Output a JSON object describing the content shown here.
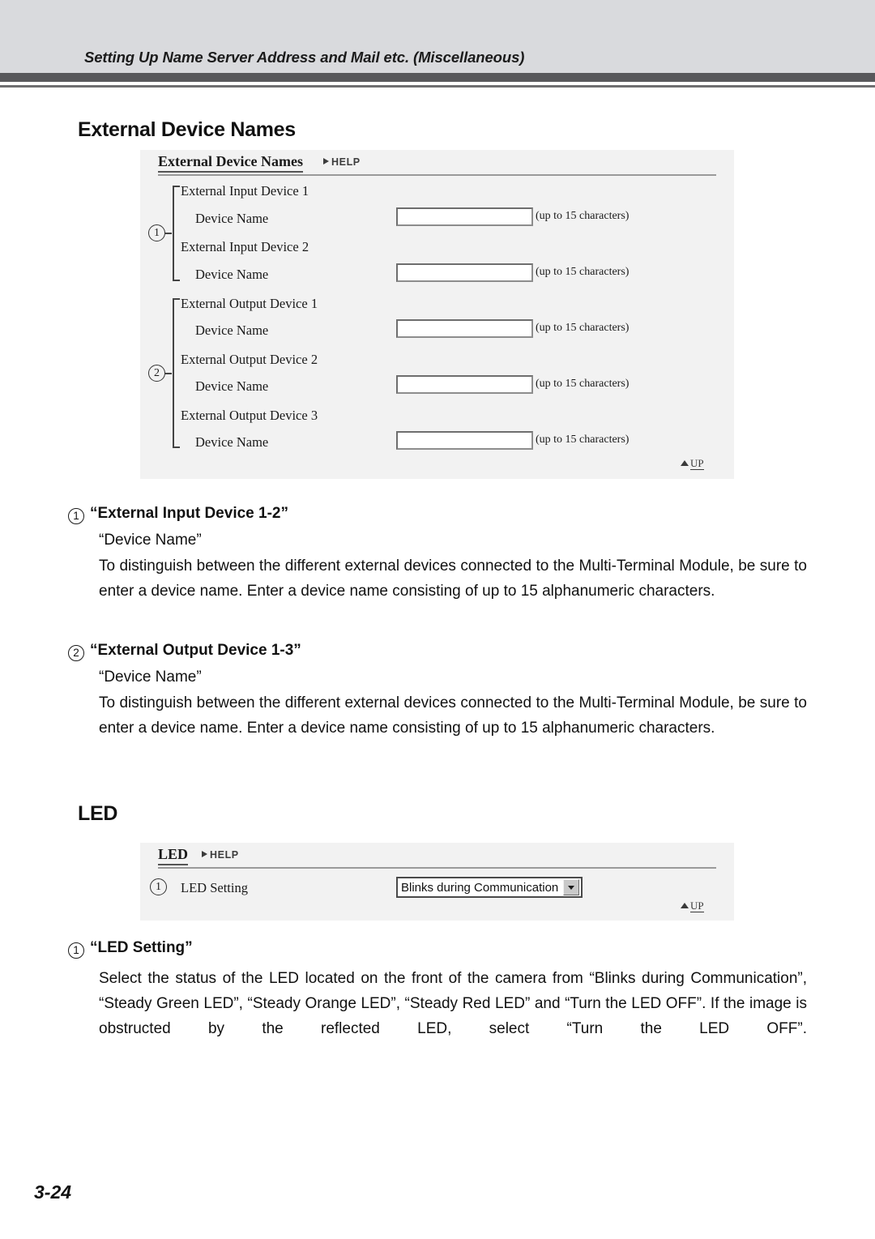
{
  "header": {
    "running_title": "Setting Up Name Server Address and Mail etc. (Miscellaneous)"
  },
  "sections": {
    "external_device_names": {
      "heading": "External Device Names",
      "panel": {
        "title": "External Device Names",
        "help_label": "HELP",
        "up_label": "UP",
        "rows": [
          {
            "group": "External Input Device 1",
            "field": "Device Name",
            "value": "",
            "hint": "(up to 15 characters)"
          },
          {
            "group": "External Input Device 2",
            "field": "Device Name",
            "value": "",
            "hint": "(up to 15 characters)"
          },
          {
            "group": "External Output Device 1",
            "field": "Device Name",
            "value": "",
            "hint": "(up to 15 characters)"
          },
          {
            "group": "External Output Device 2",
            "field": "Device Name",
            "value": "",
            "hint": "(up to 15 characters)"
          },
          {
            "group": "External Output Device 3",
            "field": "Device Name",
            "value": "",
            "hint": "(up to 15 characters)"
          }
        ],
        "callout_1": "1",
        "callout_2": "2"
      },
      "explanations": [
        {
          "num": "1",
          "title": "“External Input Device 1-2”",
          "sub": "“Device Name”",
          "body": "To distinguish between the different external devices connected to the Multi-Terminal Module, be sure to enter a device name. Enter a device name consisting of up to 15 alphanumeric characters."
        },
        {
          "num": "2",
          "title": "“External Output Device 1-3”",
          "sub": "“Device Name”",
          "body": "To distinguish between the different external devices connected to the Multi-Terminal Module, be sure to enter a device name. Enter a device name consisting of up to 15 alphanumeric characters."
        }
      ]
    },
    "led": {
      "heading": "LED",
      "panel": {
        "title": "LED",
        "help_label": "HELP",
        "up_label": "UP",
        "callout_1": "1",
        "setting_label": "LED Setting",
        "setting_value": "Blinks during Communication"
      },
      "explanations": [
        {
          "num": "1",
          "title": "“LED Setting”",
          "body": "Select the status of the LED located on the front of the camera from “Blinks during Communication”, “Steady Green LED”, “Steady Orange LED”, “Steady Red LED” and “Turn the LED OFF”. If the image is obstructed by the reflected LED, select “Turn the LED OFF”."
        }
      ]
    }
  },
  "footer": {
    "page_number": "3-24"
  }
}
